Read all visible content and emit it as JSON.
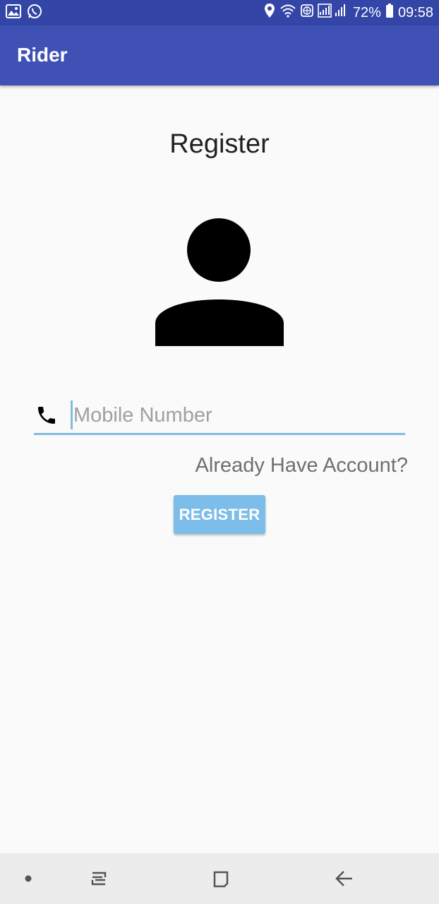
{
  "status_bar": {
    "battery": "72%",
    "time": "09:58",
    "icons": [
      "gallery-icon",
      "whatsapp-icon",
      "location-icon",
      "wifi-icon",
      "globe-icon",
      "signal-icon",
      "battery-icon"
    ]
  },
  "app_bar": {
    "title": "Rider"
  },
  "main": {
    "heading": "Register",
    "mobile_field": {
      "placeholder": "Mobile Number",
      "value": ""
    },
    "login_link": "Already Have Account?",
    "register_button": "REGISTER"
  },
  "colors": {
    "status_bar": "#3345a6",
    "app_bar": "#3f51b5",
    "accent": "#7fbde0",
    "button": "#7dbde9"
  },
  "nav_bar": {
    "icons": [
      "dot-icon",
      "recent-apps-icon",
      "home-icon",
      "back-icon"
    ]
  }
}
